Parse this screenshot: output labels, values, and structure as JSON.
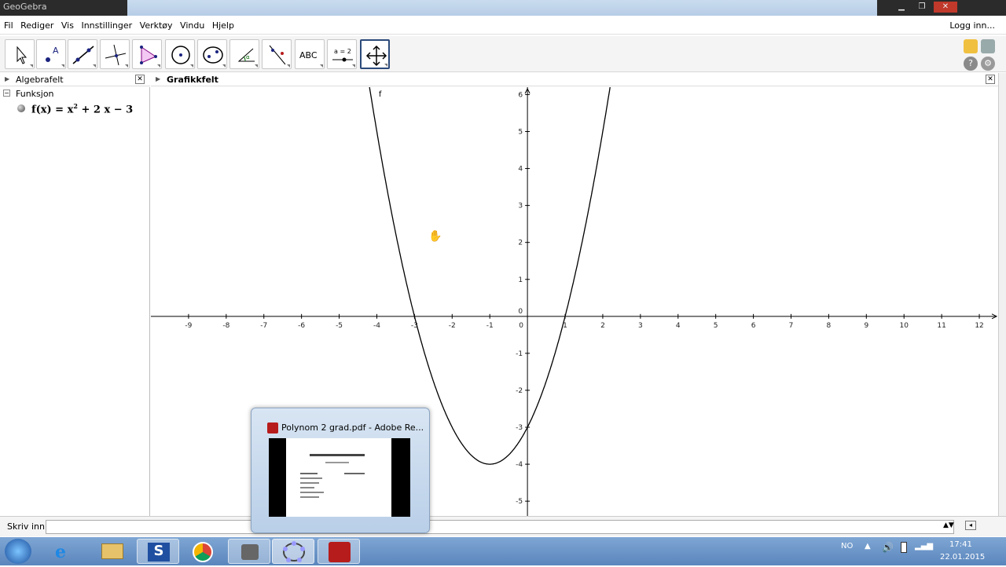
{
  "window": {
    "title": "GeoGebra"
  },
  "menu": {
    "items": [
      "Fil",
      "Rediger",
      "Vis",
      "Innstillinger",
      "Verktøy",
      "Vindu",
      "Hjelp"
    ],
    "login": "Logg inn..."
  },
  "toolbar": {
    "tools": [
      "move-tool",
      "point-tool",
      "line-tool",
      "perpendicular-line-tool",
      "polygon-tool",
      "circle-tool",
      "conic-tool",
      "angle-tool",
      "reflect-tool",
      "text-tool",
      "slider-tool",
      "move-graphics-view-tool"
    ],
    "text_tool_label": "ABC",
    "slider_tool_label": "a = 2"
  },
  "algebra": {
    "title": "Algebrafelt",
    "group": "Funksjon",
    "function_prefix": "f(x) = x",
    "function_exp": "2",
    "function_suffix": " + 2 x − 3"
  },
  "graphics": {
    "title": "Grafikkfelt",
    "curve_label": "f",
    "x_ticks": [
      "-9",
      "-8",
      "-7",
      "-6",
      "-5",
      "-4",
      "-3",
      "-2",
      "-1",
      "0",
      "1",
      "2",
      "3",
      "4",
      "5",
      "6",
      "7",
      "8",
      "9",
      "10",
      "11",
      "12"
    ],
    "y_ticks": [
      "6",
      "5",
      "4",
      "3",
      "2",
      "1",
      "0",
      "-1",
      "-2",
      "-3",
      "-4",
      "-5"
    ]
  },
  "chart_data": {
    "type": "line",
    "title": "",
    "xlabel": "",
    "ylabel": "",
    "xlim": [
      -10,
      12.5
    ],
    "ylim": [
      -5.4,
      6.2
    ],
    "series": [
      {
        "name": "f",
        "function": "x^2 + 2x - 3"
      }
    ],
    "grid": false
  },
  "input": {
    "label": "Skriv inn:"
  },
  "popup": {
    "title": "Polynom 2 grad.pdf - Adobe Re..."
  },
  "taskbar": {
    "lang": "NO",
    "time": "17:41",
    "date": "22.01.2015"
  }
}
